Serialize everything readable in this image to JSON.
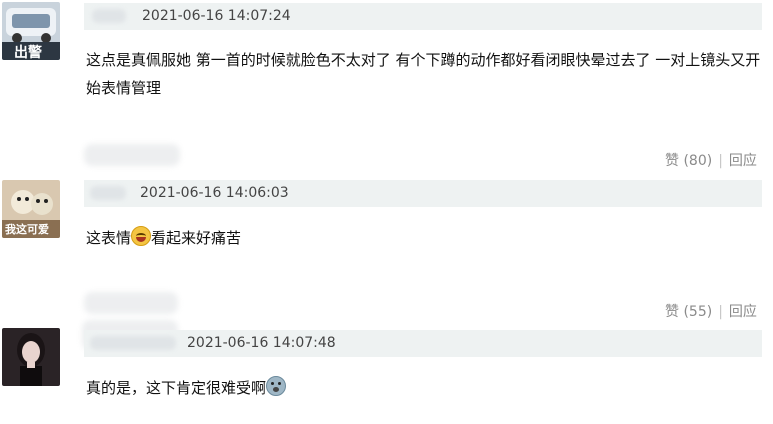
{
  "comments": [
    {
      "avatar_text": "出警",
      "timestamp": "2021-06-16 14:07:24",
      "text": "这点是真佩服她 第一首的时候就脸色不太对了 有个下蹲的动作都好看闭眼快晕过去了 一对上镜头又开始表情管理",
      "likes_label": "赞 (80)",
      "reply_label": "回应"
    },
    {
      "avatar_text": "我这可爱",
      "timestamp": "2021-06-16 14:06:03",
      "text_before_emoji": "这表情",
      "emoji": "laughing-crying-emoji",
      "text_after_emoji": "看起来好痛苦",
      "likes_label": "赞 (55)",
      "reply_label": "回应"
    },
    {
      "timestamp": "2021-06-16 14:07:48",
      "text_before_emoji": "真的是，这下肯定很难受啊",
      "emoji": "anxious-sweat-emoji"
    }
  ],
  "colors": {
    "meta_bar": "#eef2f2",
    "action_text": "#8a8a8a",
    "body_text": "#111111"
  }
}
